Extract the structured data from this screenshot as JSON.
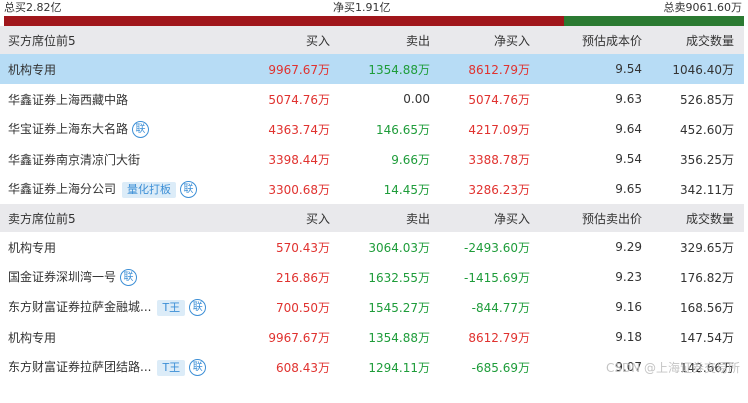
{
  "summary": {
    "total_buy": "总买2.82亿",
    "net_buy": "净买1.91亿",
    "total_sell": "总卖9061.60万",
    "buy_fraction": 0.757
  },
  "buy_section": {
    "headers": [
      "买方席位前5",
      "买入",
      "卖出",
      "净买入",
      "预估成本价",
      "成交数量"
    ],
    "rows": [
      {
        "name": "机构专用",
        "buy": "9967.67万",
        "sell": "1354.88万",
        "net": "8612.79万",
        "price": "9.54",
        "volume": "1046.40万",
        "tag": "",
        "lian": false,
        "highlight": true
      },
      {
        "name": "华鑫证券上海西藏中路",
        "buy": "5074.76万",
        "sell": "0.00",
        "net": "5074.76万",
        "price": "9.63",
        "volume": "526.85万",
        "tag": "",
        "lian": false,
        "highlight": false
      },
      {
        "name": "华宝证券上海东大名路",
        "buy": "4363.74万",
        "sell": "146.65万",
        "net": "4217.09万",
        "price": "9.64",
        "volume": "452.60万",
        "tag": "",
        "lian": true,
        "highlight": false
      },
      {
        "name": "华鑫证券南京清凉门大街",
        "buy": "3398.44万",
        "sell": "9.66万",
        "net": "3388.78万",
        "price": "9.54",
        "volume": "356.25万",
        "tag": "",
        "lian": false,
        "highlight": false
      },
      {
        "name": "华鑫证券上海分公司",
        "buy": "3300.68万",
        "sell": "14.45万",
        "net": "3286.23万",
        "price": "9.65",
        "volume": "342.11万",
        "tag": "量化打板",
        "lian": true,
        "highlight": false
      }
    ]
  },
  "sell_section": {
    "headers": [
      "卖方席位前5",
      "买入",
      "卖出",
      "净买入",
      "预估卖出价",
      "成交数量"
    ],
    "rows": [
      {
        "name": "机构专用",
        "buy": "570.43万",
        "sell": "3064.03万",
        "net": "-2493.60万",
        "price": "9.29",
        "volume": "329.65万",
        "tag": "",
        "lian": false
      },
      {
        "name": "国金证券深圳湾一号",
        "buy": "216.86万",
        "sell": "1632.55万",
        "net": "-1415.69万",
        "price": "9.23",
        "volume": "176.82万",
        "tag": "",
        "lian": true
      },
      {
        "name": "东方财富证券拉萨金融城...",
        "buy": "700.50万",
        "sell": "1545.27万",
        "net": "-844.77万",
        "price": "9.16",
        "volume": "168.56万",
        "tag": "T王",
        "lian": true
      },
      {
        "name": "机构专用",
        "buy": "9967.67万",
        "sell": "1354.88万",
        "net": "8612.79万",
        "price": "9.18",
        "volume": "147.54万",
        "tag": "",
        "lian": false
      },
      {
        "name": "东方财富证券拉萨团结路...",
        "buy": "608.43万",
        "sell": "1294.11万",
        "net": "-685.69万",
        "price": "9.07",
        "volume": "142.66万",
        "tag": "T王",
        "lian": true
      }
    ]
  },
  "lian_label": "联",
  "watermark": "CSDN @上海证券交易所",
  "colors": {
    "red": "#e0322f",
    "green": "#1e9c3a",
    "highlight": "#b7dcf5",
    "bar_buy": "#a0161b",
    "bar_sell": "#2b7a32"
  }
}
